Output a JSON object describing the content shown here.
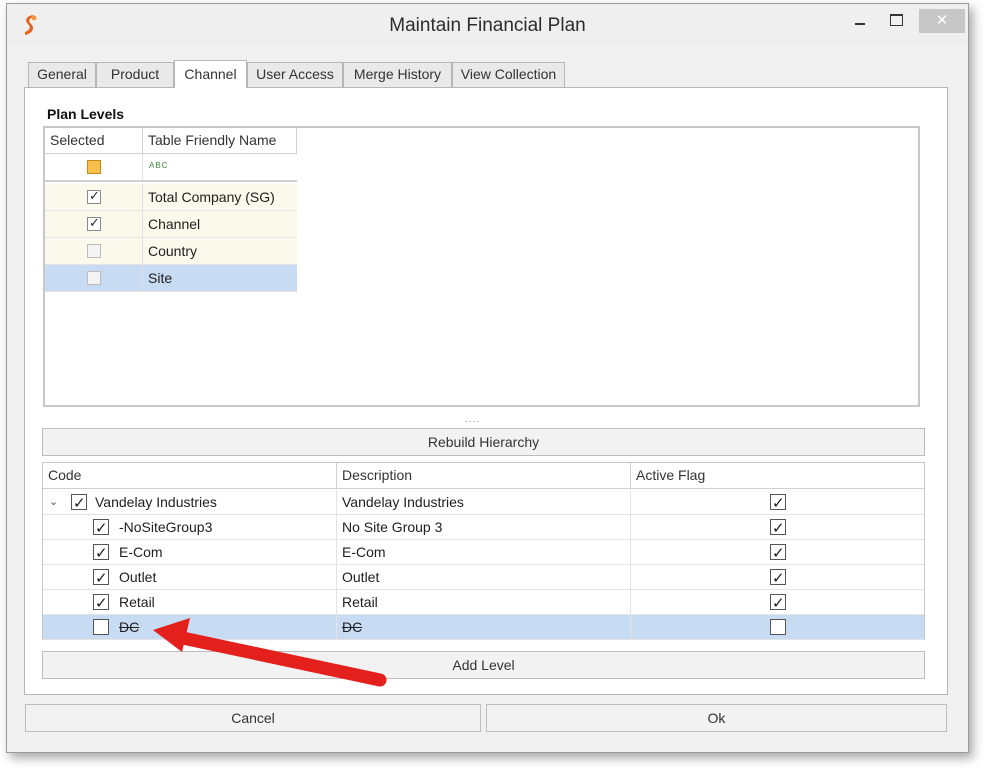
{
  "window": {
    "title": "Maintain Financial Plan",
    "close_glyph": "✕"
  },
  "tabs": [
    {
      "label": "General"
    },
    {
      "label": "Product"
    },
    {
      "label": "Channel"
    },
    {
      "label": "User Access"
    },
    {
      "label": "Merge History"
    },
    {
      "label": "View Collection"
    }
  ],
  "plan_levels": {
    "title": "Plan Levels",
    "columns": [
      "Selected",
      "Table Friendly Name"
    ],
    "filter_icon": "abc-filter-icon",
    "filter_text": "ABC",
    "rows": [
      {
        "selected": true,
        "name": "Total Company (SG)"
      },
      {
        "selected": true,
        "name": "Channel"
      },
      {
        "selected": false,
        "name": "Country"
      },
      {
        "selected": false,
        "name": "Site"
      }
    ]
  },
  "splitter": "....",
  "rebuild_label": "Rebuild Hierarchy",
  "hierarchy": {
    "columns": [
      "Code",
      "Description",
      "Active Flag"
    ],
    "expander_glyph": "⌄",
    "rows": [
      {
        "checked": true,
        "code": "Vandelay Industries",
        "description": "Vandelay Industries",
        "active": true
      },
      {
        "checked": true,
        "code": "-NoSiteGroup3",
        "description": "No Site Group 3",
        "active": true
      },
      {
        "checked": true,
        "code": "E-Com",
        "description": "E-Com",
        "active": true
      },
      {
        "checked": true,
        "code": "Outlet",
        "description": "Outlet",
        "active": true
      },
      {
        "checked": true,
        "code": "Retail",
        "description": "Retail",
        "active": true
      },
      {
        "checked": false,
        "code": "DC",
        "description": "DC",
        "active": false
      }
    ]
  },
  "add_level_label": "Add Level",
  "footer": {
    "cancel_label": "Cancel",
    "ok_label": "Ok"
  },
  "colors": {
    "selected_row": "#c7dbf2",
    "alt_row": "#fbf8ec",
    "arrow": "#e3201b"
  }
}
